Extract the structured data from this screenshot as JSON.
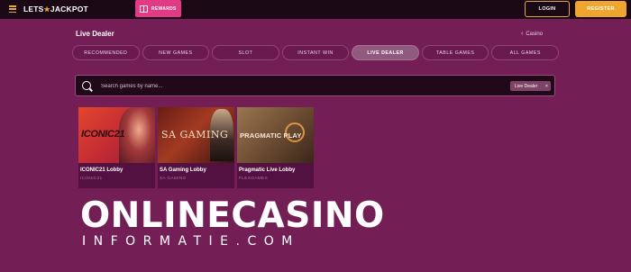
{
  "topbar": {
    "logo_left": "LETS",
    "logo_right": "JACKPOT",
    "rewards_label": "REWARDS",
    "login_label": "LOGIN",
    "register_label": "REGISTER",
    "menu_icon": "hamburger-icon",
    "rewards_icon": "gift-icon"
  },
  "header": {
    "title": "Live Dealer",
    "breadcrumb": "Casino"
  },
  "tabs": [
    {
      "label": "Recommended",
      "active": false
    },
    {
      "label": "New Games",
      "active": false
    },
    {
      "label": "Slot",
      "active": false
    },
    {
      "label": "Instant Win",
      "active": false
    },
    {
      "label": "Live Dealer",
      "active": true
    },
    {
      "label": "Table Games",
      "active": false
    },
    {
      "label": "All Games",
      "active": false
    }
  ],
  "search": {
    "placeholder": "Search games by name...",
    "value": "",
    "filter_chip": "Live Dealer",
    "filter_close": "×"
  },
  "games": [
    {
      "title": "ICONIC21 Lobby",
      "provider": "ICONIC21",
      "image_text": "ICONIC21"
    },
    {
      "title": "SA Gaming Lobby",
      "provider": "SA GAMING",
      "image_text": "SA GAMING"
    },
    {
      "title": "Pragmatic Live Lobby",
      "provider": "FLEXGAMES",
      "image_text": "PRAGMATIC PLAY"
    }
  ],
  "watermark": {
    "line1": "ONLINECASINO",
    "line2": "INFORMATIE.COM"
  },
  "colors": {
    "background": "#731f55",
    "topbar": "#1a0814",
    "accent": "#f0a52e",
    "rewards": "#e33a86"
  }
}
